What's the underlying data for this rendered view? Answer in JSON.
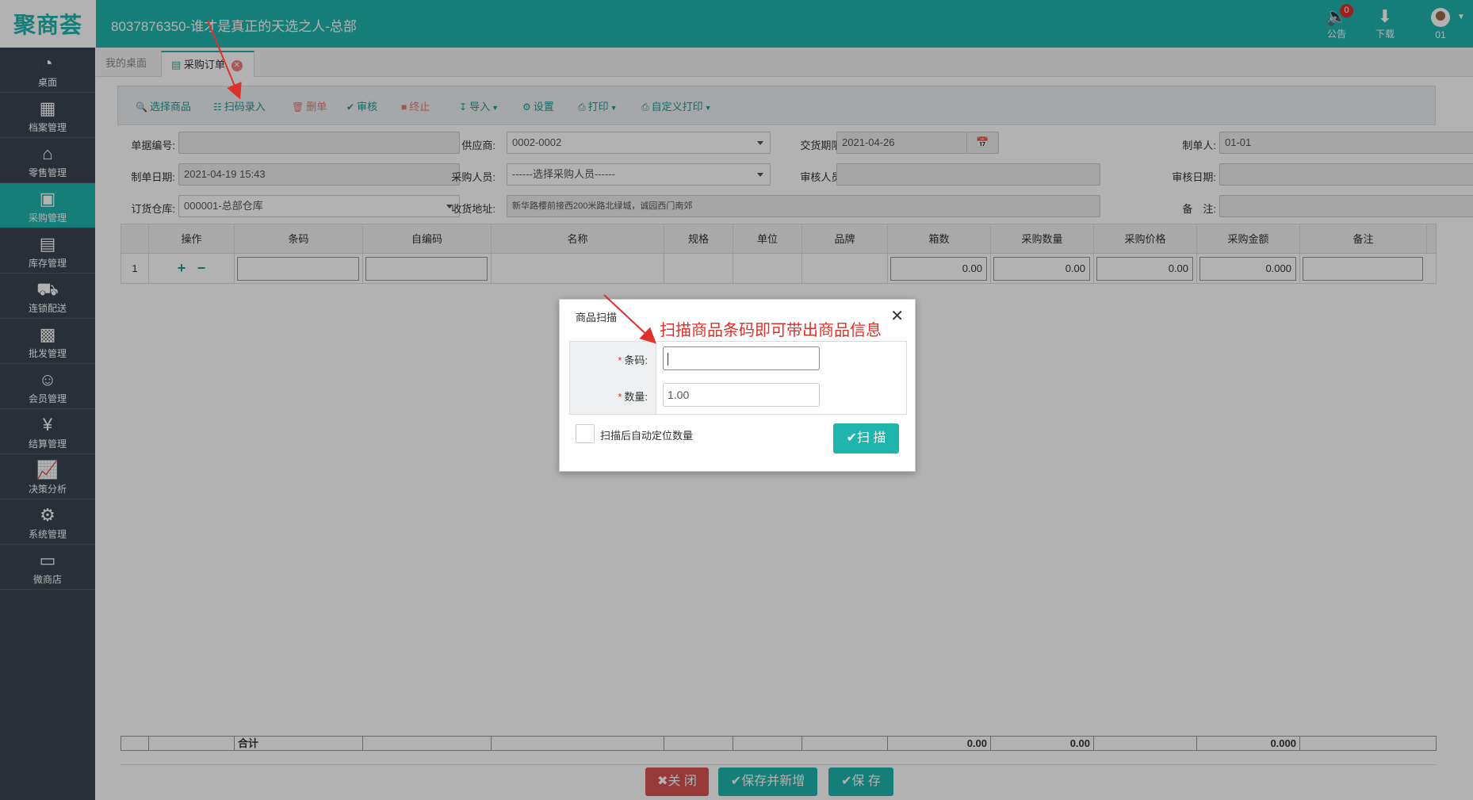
{
  "header": {
    "logo": "聚商荟",
    "title": "8037876350-谁才是真正的天选之人-总部",
    "notice_label": "公告",
    "notice_count": "0",
    "download_label": "下载",
    "user_label": "01"
  },
  "sidebar": {
    "items": [
      {
        "label": "桌面",
        "icon": "dashboard-icon"
      },
      {
        "label": "档案管理",
        "icon": "archive-icon"
      },
      {
        "label": "零售管理",
        "icon": "store-icon"
      },
      {
        "label": "采购管理",
        "icon": "cart-icon"
      },
      {
        "label": "库存管理",
        "icon": "inventory-icon"
      },
      {
        "label": "连锁配送",
        "icon": "truck-icon"
      },
      {
        "label": "批发管理",
        "icon": "wholesale-icon"
      },
      {
        "label": "会员管理",
        "icon": "member-icon"
      },
      {
        "label": "结算管理",
        "icon": "settlement-icon"
      },
      {
        "label": "决策分析",
        "icon": "chart-icon"
      },
      {
        "label": "系统管理",
        "icon": "gear-icon"
      },
      {
        "label": "微商店",
        "icon": "shop-bag-icon"
      }
    ],
    "active_index": 3
  },
  "tabs": {
    "home": "我的桌面",
    "active": "采购订单"
  },
  "toolbar": {
    "select_goods": "选择商品",
    "scan_entry": "扫码录入",
    "delete": "删单",
    "audit": "审核",
    "terminate": "终止",
    "import": "导入",
    "settings": "设置",
    "print": "打印",
    "custom_print": "自定义打印"
  },
  "form": {
    "doc_no_label": "单据编号:",
    "doc_no": "",
    "supplier_label": "供应商:",
    "supplier": "0002-0002",
    "delivery_label": "交货期限:",
    "delivery": "2021-04-26",
    "maker_label": "制单人:",
    "maker": "01-01",
    "make_date_label": "制单日期:",
    "make_date": "2021-04-19 15:43",
    "buyer_label": "采购人员:",
    "buyer": "------选择采购人员------",
    "auditor_label": "审核人员:",
    "auditor": "",
    "audit_date_label": "审核日期:",
    "audit_date": "",
    "warehouse_label": "订货仓库:",
    "warehouse": "000001-总部仓库",
    "address_label": "收货地址:",
    "address": "新华路樱前接西200米路北绿城，诚园西门南郊",
    "remark_label": "备　注:",
    "remark": ""
  },
  "grid": {
    "headers": [
      "操作",
      "条码",
      "自编码",
      "名称",
      "规格",
      "单位",
      "品牌",
      "箱数",
      "采购数量",
      "采购价格",
      "采购金额",
      "备注"
    ],
    "row": {
      "index": "1",
      "add": "+",
      "remove": "−",
      "boxes": "0.00",
      "qty": "0.00",
      "price": "0.00",
      "amount": "0.000"
    },
    "footer": {
      "label": "合计",
      "boxes": "0.00",
      "qty": "0.00",
      "amount": "0.000"
    }
  },
  "bottom": {
    "close": "关 闭",
    "save_new": "保存并新增",
    "save": "保 存"
  },
  "modal": {
    "title": "商品扫描",
    "barcode_label": "条码:",
    "barcode_value": "",
    "qty_label": "数量:",
    "qty_value": "1.00",
    "auto_locate_label": "扫描后自动定位数量",
    "scan_button": "扫 描"
  },
  "annotation": "扫描商品条码即可带出商品信息",
  "colors": {
    "brand": "#1fb5ac",
    "sidebar": "#3b4451",
    "danger": "#d9534f",
    "annotation": "#e0302a"
  }
}
